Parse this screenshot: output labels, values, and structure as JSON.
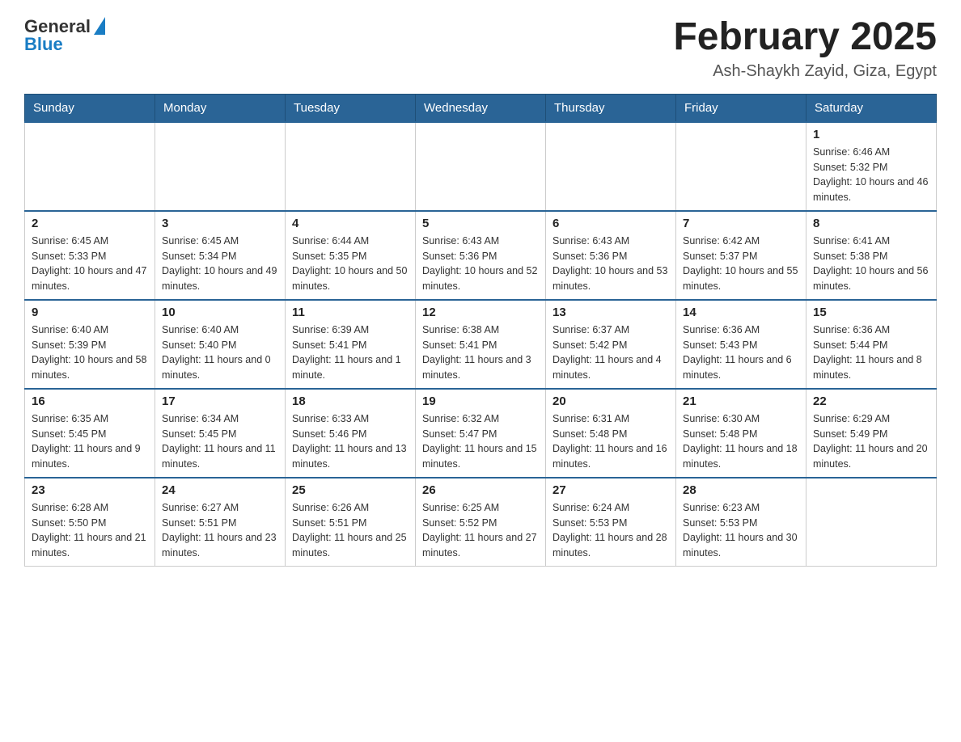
{
  "header": {
    "logo": {
      "general": "General",
      "blue": "Blue"
    },
    "title": "February 2025",
    "subtitle": "Ash-Shaykh Zayid, Giza, Egypt"
  },
  "days_of_week": [
    "Sunday",
    "Monday",
    "Tuesday",
    "Wednesday",
    "Thursday",
    "Friday",
    "Saturday"
  ],
  "weeks": [
    [
      {
        "day": "",
        "info": ""
      },
      {
        "day": "",
        "info": ""
      },
      {
        "day": "",
        "info": ""
      },
      {
        "day": "",
        "info": ""
      },
      {
        "day": "",
        "info": ""
      },
      {
        "day": "",
        "info": ""
      },
      {
        "day": "1",
        "info": "Sunrise: 6:46 AM\nSunset: 5:32 PM\nDaylight: 10 hours and 46 minutes."
      }
    ],
    [
      {
        "day": "2",
        "info": "Sunrise: 6:45 AM\nSunset: 5:33 PM\nDaylight: 10 hours and 47 minutes."
      },
      {
        "day": "3",
        "info": "Sunrise: 6:45 AM\nSunset: 5:34 PM\nDaylight: 10 hours and 49 minutes."
      },
      {
        "day": "4",
        "info": "Sunrise: 6:44 AM\nSunset: 5:35 PM\nDaylight: 10 hours and 50 minutes."
      },
      {
        "day": "5",
        "info": "Sunrise: 6:43 AM\nSunset: 5:36 PM\nDaylight: 10 hours and 52 minutes."
      },
      {
        "day": "6",
        "info": "Sunrise: 6:43 AM\nSunset: 5:36 PM\nDaylight: 10 hours and 53 minutes."
      },
      {
        "day": "7",
        "info": "Sunrise: 6:42 AM\nSunset: 5:37 PM\nDaylight: 10 hours and 55 minutes."
      },
      {
        "day": "8",
        "info": "Sunrise: 6:41 AM\nSunset: 5:38 PM\nDaylight: 10 hours and 56 minutes."
      }
    ],
    [
      {
        "day": "9",
        "info": "Sunrise: 6:40 AM\nSunset: 5:39 PM\nDaylight: 10 hours and 58 minutes."
      },
      {
        "day": "10",
        "info": "Sunrise: 6:40 AM\nSunset: 5:40 PM\nDaylight: 11 hours and 0 minutes."
      },
      {
        "day": "11",
        "info": "Sunrise: 6:39 AM\nSunset: 5:41 PM\nDaylight: 11 hours and 1 minute."
      },
      {
        "day": "12",
        "info": "Sunrise: 6:38 AM\nSunset: 5:41 PM\nDaylight: 11 hours and 3 minutes."
      },
      {
        "day": "13",
        "info": "Sunrise: 6:37 AM\nSunset: 5:42 PM\nDaylight: 11 hours and 4 minutes."
      },
      {
        "day": "14",
        "info": "Sunrise: 6:36 AM\nSunset: 5:43 PM\nDaylight: 11 hours and 6 minutes."
      },
      {
        "day": "15",
        "info": "Sunrise: 6:36 AM\nSunset: 5:44 PM\nDaylight: 11 hours and 8 minutes."
      }
    ],
    [
      {
        "day": "16",
        "info": "Sunrise: 6:35 AM\nSunset: 5:45 PM\nDaylight: 11 hours and 9 minutes."
      },
      {
        "day": "17",
        "info": "Sunrise: 6:34 AM\nSunset: 5:45 PM\nDaylight: 11 hours and 11 minutes."
      },
      {
        "day": "18",
        "info": "Sunrise: 6:33 AM\nSunset: 5:46 PM\nDaylight: 11 hours and 13 minutes."
      },
      {
        "day": "19",
        "info": "Sunrise: 6:32 AM\nSunset: 5:47 PM\nDaylight: 11 hours and 15 minutes."
      },
      {
        "day": "20",
        "info": "Sunrise: 6:31 AM\nSunset: 5:48 PM\nDaylight: 11 hours and 16 minutes."
      },
      {
        "day": "21",
        "info": "Sunrise: 6:30 AM\nSunset: 5:48 PM\nDaylight: 11 hours and 18 minutes."
      },
      {
        "day": "22",
        "info": "Sunrise: 6:29 AM\nSunset: 5:49 PM\nDaylight: 11 hours and 20 minutes."
      }
    ],
    [
      {
        "day": "23",
        "info": "Sunrise: 6:28 AM\nSunset: 5:50 PM\nDaylight: 11 hours and 21 minutes."
      },
      {
        "day": "24",
        "info": "Sunrise: 6:27 AM\nSunset: 5:51 PM\nDaylight: 11 hours and 23 minutes."
      },
      {
        "day": "25",
        "info": "Sunrise: 6:26 AM\nSunset: 5:51 PM\nDaylight: 11 hours and 25 minutes."
      },
      {
        "day": "26",
        "info": "Sunrise: 6:25 AM\nSunset: 5:52 PM\nDaylight: 11 hours and 27 minutes."
      },
      {
        "day": "27",
        "info": "Sunrise: 6:24 AM\nSunset: 5:53 PM\nDaylight: 11 hours and 28 minutes."
      },
      {
        "day": "28",
        "info": "Sunrise: 6:23 AM\nSunset: 5:53 PM\nDaylight: 11 hours and 30 minutes."
      },
      {
        "day": "",
        "info": ""
      }
    ]
  ]
}
